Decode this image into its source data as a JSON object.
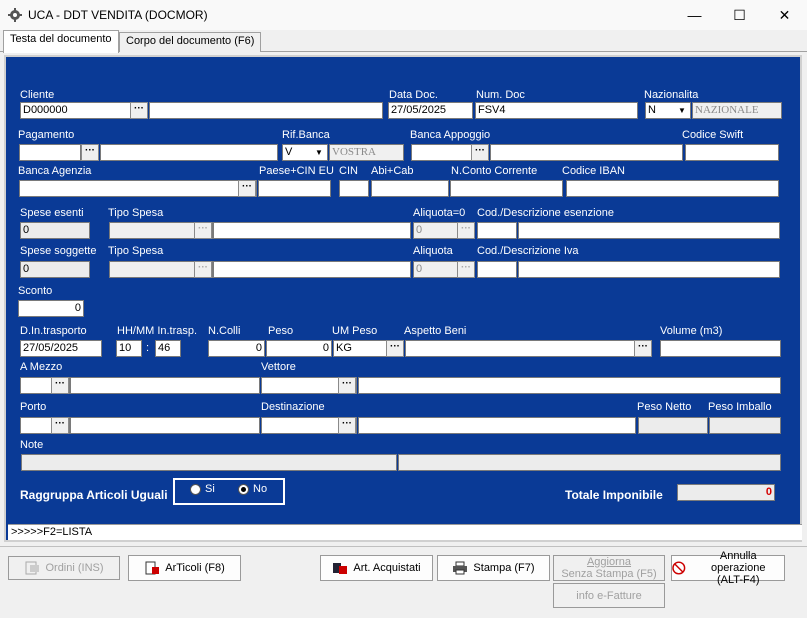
{
  "window": {
    "title": "UCA - DDT VENDITA (DOCMOR)",
    "min": "—",
    "max": "☐",
    "close": "✕"
  },
  "tabs": [
    "Testa del documento",
    "Corpo del documento (F6)"
  ],
  "form": {
    "cliente_lbl": "Cliente",
    "cliente": "D000000",
    "cliente_name": "",
    "data_lbl": "Data Doc.",
    "data": "27/05/2025",
    "num_lbl": "Num. Doc",
    "num": "FSV4",
    "naz_lbl": "Nazionalita",
    "naz": "N",
    "naz_desc": "NAZIONALE",
    "pag_lbl": "Pagamento",
    "pag": "",
    "pag_desc": "",
    "rifbanca_lbl": "Rif.Banca",
    "rifbanca": "V",
    "rifbanca_desc": "VOSTRA",
    "bancaapp_lbl": "Banca Appoggio",
    "bancaapp": "",
    "bancaapp_desc": "",
    "swift_lbl": "Codice Swift",
    "swift": "",
    "bancaag_lbl": "Banca Agenzia",
    "bancaag": "",
    "paesecin_lbl": "Paese+CIN EU",
    "paesecin": "",
    "cin_lbl": "CIN",
    "cin": "",
    "abicab_lbl": "Abi+Cab",
    "abicab": "",
    "nconto_lbl": "N.Conto Corrente",
    "nconto": "",
    "iban_lbl": "Codice IBAN",
    "iban": "",
    "spese_es_lbl": "Spese esenti",
    "spese_es": "0",
    "tipospesa1_lbl": "Tipo Spesa",
    "aliq0_lbl": "Aliquota=0",
    "aliq0": "0",
    "codesenz_lbl": "Cod./Descrizione esenzione",
    "spese_sog_lbl": "Spese soggette",
    "spese_sog": "0",
    "tipospesa2_lbl": "Tipo Spesa",
    "aliq_lbl": "Aliquota",
    "aliq": "0",
    "codiva_lbl": "Cod./Descrizione Iva",
    "sconto_lbl": "Sconto",
    "sconto": "0",
    "dintr_lbl": "D.In.trasporto",
    "dintr": "27/05/2025",
    "hhmm_lbl": "HH/MM In.trasp.",
    "hh": "10",
    "mm": "46",
    "colon": ":",
    "ncolli_lbl": "N.Colli",
    "ncolli": "0",
    "peso_lbl": "Peso",
    "peso": "0",
    "umpeso_lbl": "UM Peso",
    "umpeso": "KG",
    "aspetto_lbl": "Aspetto Beni",
    "aspetto": "",
    "volume_lbl": "Volume (m3)",
    "volume": "",
    "amezzo_lbl": "A Mezzo",
    "vettore_lbl": "Vettore",
    "porto_lbl": "Porto",
    "dest_lbl": "Destinazione",
    "pesonetto_lbl": "Peso Netto",
    "pesoimb_lbl": "Peso Imballo",
    "note_lbl": "Note",
    "raggruppa_lbl": "Raggruppa Articoli Uguali",
    "si": "Si",
    "no": "No",
    "totale_lbl": "Totale Imponibile",
    "totale": "0",
    "status": ">>>>>F2=LISTA",
    "dots": "···"
  },
  "buttons": {
    "ordini": "Ordini (INS)",
    "articoli": "ArTicoli (F8)",
    "art_acq": "Art. Acquistati",
    "stampa": "Stampa  (F7)",
    "aggiorna1": "Aggiorna",
    "aggiorna2": "Senza Stampa  (F5)",
    "annulla1": "Annulla operazione",
    "annulla2": "(ALT-F4)",
    "efatture": "info e-Fatture"
  },
  "colors": {
    "panel": "#0a3a96",
    "total_red": "#d40000"
  }
}
